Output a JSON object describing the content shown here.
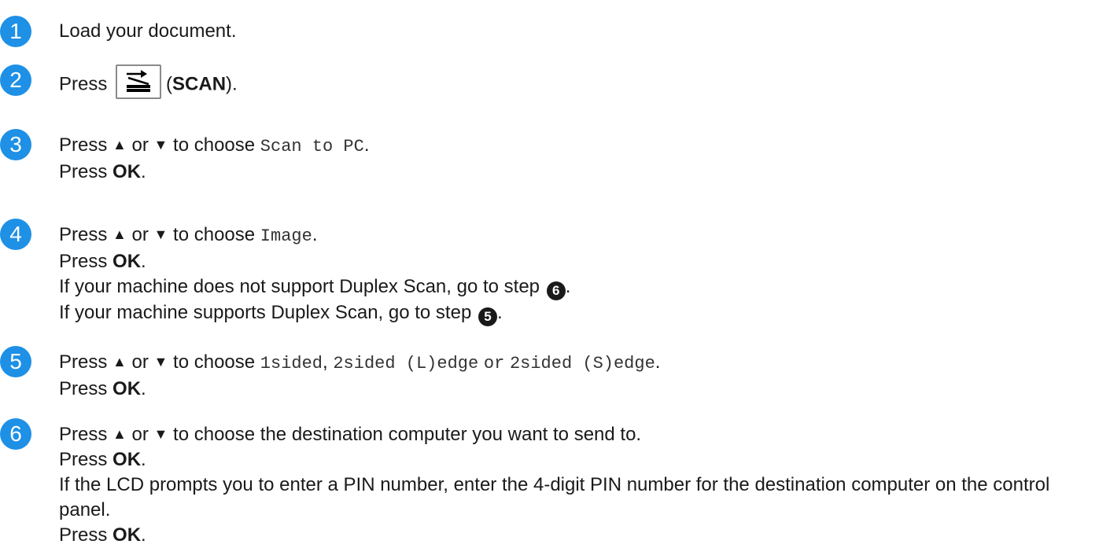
{
  "steps": [
    {
      "num": "1",
      "text": "Load your document."
    },
    {
      "num": "2",
      "press": "Press",
      "button_label": "SCAN"
    },
    {
      "num": "3",
      "press": "Press",
      "up": "▲",
      "or": "or",
      "down": "▼",
      "to_choose": "to choose",
      "option": "Scan to PC",
      "period": ".",
      "press_ok_pre": "Press",
      "ok": "OK",
      "press_ok_post": "."
    },
    {
      "num": "4",
      "press": "Press",
      "up": "▲",
      "or": "or",
      "down": "▼",
      "to_choose": "to choose",
      "option": "Image",
      "period": ".",
      "press_ok_pre": "Press",
      "ok": "OK",
      "press_ok_post": ".",
      "note1": "If your machine does not support Duplex Scan, go to step",
      "note1_ref": "6",
      "note2": "If your machine supports Duplex Scan, go to step",
      "note2_ref": "5"
    },
    {
      "num": "5",
      "press": "Press",
      "up": "▲",
      "or": "or",
      "down": "▼",
      "to_choose": "to choose",
      "opt1": "1sided",
      "comma": ",",
      "opt2": "2sided (L)edge",
      "or2": "or",
      "opt3": "2sided (S)edge",
      "period": ".",
      "press_ok_pre": "Press",
      "ok": "OK",
      "press_ok_post": "."
    },
    {
      "num": "6",
      "press": "Press",
      "up": "▲",
      "or": "or",
      "down": "▼",
      "rest": "to choose the destination computer you want to send to.",
      "press_ok_pre": "Press",
      "ok": "OK",
      "press_ok_post": ".",
      "note": "If the LCD prompts you to enter a PIN number, enter the 4-digit PIN number for the destination computer on the control panel.",
      "press_ok2_pre": "Press",
      "ok2": "OK",
      "press_ok2_post": "."
    }
  ],
  "colors": {
    "step_badge": "#1e90e6",
    "text": "#1a1a1a"
  },
  "icons": {
    "scan_button": "scan-tray-icon"
  }
}
